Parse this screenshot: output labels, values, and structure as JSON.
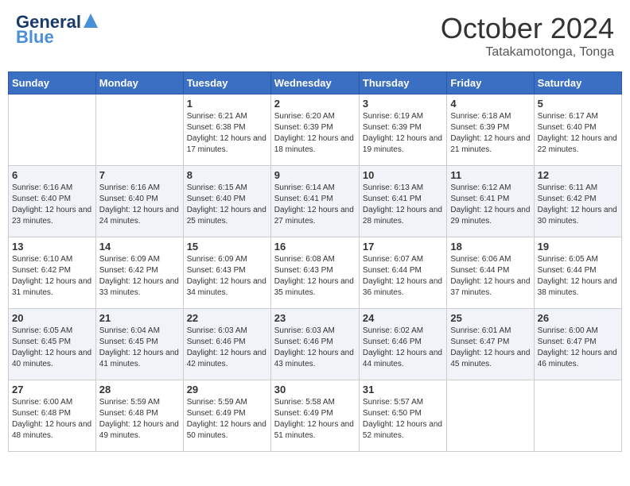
{
  "header": {
    "logo_line1": "General",
    "logo_line2": "Blue",
    "month_year": "October 2024",
    "location": "Tatakamotonga, Tonga"
  },
  "weekdays": [
    "Sunday",
    "Monday",
    "Tuesday",
    "Wednesday",
    "Thursday",
    "Friday",
    "Saturday"
  ],
  "weeks": [
    [
      {
        "day": "",
        "info": ""
      },
      {
        "day": "",
        "info": ""
      },
      {
        "day": "1",
        "info": "Sunrise: 6:21 AM\nSunset: 6:38 PM\nDaylight: 12 hours and 17 minutes."
      },
      {
        "day": "2",
        "info": "Sunrise: 6:20 AM\nSunset: 6:39 PM\nDaylight: 12 hours and 18 minutes."
      },
      {
        "day": "3",
        "info": "Sunrise: 6:19 AM\nSunset: 6:39 PM\nDaylight: 12 hours and 19 minutes."
      },
      {
        "day": "4",
        "info": "Sunrise: 6:18 AM\nSunset: 6:39 PM\nDaylight: 12 hours and 21 minutes."
      },
      {
        "day": "5",
        "info": "Sunrise: 6:17 AM\nSunset: 6:40 PM\nDaylight: 12 hours and 22 minutes."
      }
    ],
    [
      {
        "day": "6",
        "info": "Sunrise: 6:16 AM\nSunset: 6:40 PM\nDaylight: 12 hours and 23 minutes."
      },
      {
        "day": "7",
        "info": "Sunrise: 6:16 AM\nSunset: 6:40 PM\nDaylight: 12 hours and 24 minutes."
      },
      {
        "day": "8",
        "info": "Sunrise: 6:15 AM\nSunset: 6:40 PM\nDaylight: 12 hours and 25 minutes."
      },
      {
        "day": "9",
        "info": "Sunrise: 6:14 AM\nSunset: 6:41 PM\nDaylight: 12 hours and 27 minutes."
      },
      {
        "day": "10",
        "info": "Sunrise: 6:13 AM\nSunset: 6:41 PM\nDaylight: 12 hours and 28 minutes."
      },
      {
        "day": "11",
        "info": "Sunrise: 6:12 AM\nSunset: 6:41 PM\nDaylight: 12 hours and 29 minutes."
      },
      {
        "day": "12",
        "info": "Sunrise: 6:11 AM\nSunset: 6:42 PM\nDaylight: 12 hours and 30 minutes."
      }
    ],
    [
      {
        "day": "13",
        "info": "Sunrise: 6:10 AM\nSunset: 6:42 PM\nDaylight: 12 hours and 31 minutes."
      },
      {
        "day": "14",
        "info": "Sunrise: 6:09 AM\nSunset: 6:42 PM\nDaylight: 12 hours and 33 minutes."
      },
      {
        "day": "15",
        "info": "Sunrise: 6:09 AM\nSunset: 6:43 PM\nDaylight: 12 hours and 34 minutes."
      },
      {
        "day": "16",
        "info": "Sunrise: 6:08 AM\nSunset: 6:43 PM\nDaylight: 12 hours and 35 minutes."
      },
      {
        "day": "17",
        "info": "Sunrise: 6:07 AM\nSunset: 6:44 PM\nDaylight: 12 hours and 36 minutes."
      },
      {
        "day": "18",
        "info": "Sunrise: 6:06 AM\nSunset: 6:44 PM\nDaylight: 12 hours and 37 minutes."
      },
      {
        "day": "19",
        "info": "Sunrise: 6:05 AM\nSunset: 6:44 PM\nDaylight: 12 hours and 38 minutes."
      }
    ],
    [
      {
        "day": "20",
        "info": "Sunrise: 6:05 AM\nSunset: 6:45 PM\nDaylight: 12 hours and 40 minutes."
      },
      {
        "day": "21",
        "info": "Sunrise: 6:04 AM\nSunset: 6:45 PM\nDaylight: 12 hours and 41 minutes."
      },
      {
        "day": "22",
        "info": "Sunrise: 6:03 AM\nSunset: 6:46 PM\nDaylight: 12 hours and 42 minutes."
      },
      {
        "day": "23",
        "info": "Sunrise: 6:03 AM\nSunset: 6:46 PM\nDaylight: 12 hours and 43 minutes."
      },
      {
        "day": "24",
        "info": "Sunrise: 6:02 AM\nSunset: 6:46 PM\nDaylight: 12 hours and 44 minutes."
      },
      {
        "day": "25",
        "info": "Sunrise: 6:01 AM\nSunset: 6:47 PM\nDaylight: 12 hours and 45 minutes."
      },
      {
        "day": "26",
        "info": "Sunrise: 6:00 AM\nSunset: 6:47 PM\nDaylight: 12 hours and 46 minutes."
      }
    ],
    [
      {
        "day": "27",
        "info": "Sunrise: 6:00 AM\nSunset: 6:48 PM\nDaylight: 12 hours and 48 minutes."
      },
      {
        "day": "28",
        "info": "Sunrise: 5:59 AM\nSunset: 6:48 PM\nDaylight: 12 hours and 49 minutes."
      },
      {
        "day": "29",
        "info": "Sunrise: 5:59 AM\nSunset: 6:49 PM\nDaylight: 12 hours and 50 minutes."
      },
      {
        "day": "30",
        "info": "Sunrise: 5:58 AM\nSunset: 6:49 PM\nDaylight: 12 hours and 51 minutes."
      },
      {
        "day": "31",
        "info": "Sunrise: 5:57 AM\nSunset: 6:50 PM\nDaylight: 12 hours and 52 minutes."
      },
      {
        "day": "",
        "info": ""
      },
      {
        "day": "",
        "info": ""
      }
    ]
  ]
}
